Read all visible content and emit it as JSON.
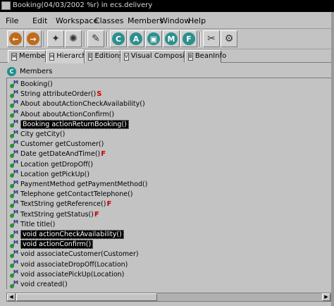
{
  "window": {
    "title": "Booking(04/03/2002 %r) in ecs.delivery"
  },
  "menu": [
    {
      "label": "File",
      "underline": "F"
    },
    {
      "label": "Edit",
      "underline": "E"
    },
    {
      "label": "Workspace",
      "underline": "W"
    },
    {
      "label": "Classes",
      "underline": "C"
    },
    {
      "label": "Members",
      "underline": "M"
    },
    {
      "label": "Window",
      "underline": "W"
    },
    {
      "label": "Help",
      "underline": "H"
    }
  ],
  "toolbar": {
    "buttons": [
      {
        "name": "back-arrow-icon",
        "glyph": "←"
      },
      {
        "name": "forward-arrow-icon",
        "glyph": "→"
      },
      {
        "name": "run-icon",
        "glyph": "✦"
      },
      {
        "name": "debug-icon",
        "glyph": "✺"
      },
      {
        "name": "search-flashlight-icon",
        "glyph": "✎"
      },
      {
        "name": "new-class-icon",
        "glyph": "C"
      },
      {
        "name": "new-applet-icon",
        "glyph": "A"
      },
      {
        "name": "new-window-icon",
        "glyph": "▣"
      },
      {
        "name": "new-method-icon",
        "glyph": "M"
      },
      {
        "name": "new-field-icon",
        "glyph": "F"
      },
      {
        "name": "cut-icon",
        "glyph": "✂"
      },
      {
        "name": "references-icon",
        "glyph": "⚙"
      }
    ]
  },
  "tabs": [
    {
      "label": "Members",
      "icon": "M"
    },
    {
      "label": "Hierarchy",
      "icon": "H"
    },
    {
      "label": "Editions",
      "icon": "E"
    },
    {
      "label": "Visual Composition",
      "icon": "V"
    },
    {
      "label": "BeanInfo",
      "icon": "B"
    }
  ],
  "active_tab": "Hierarchy",
  "panel": {
    "header_label": "Members",
    "header_icon": "C"
  },
  "members": [
    {
      "label": "Booking()",
      "selected": false,
      "flag": ""
    },
    {
      "label": "String attributeOrder()",
      "selected": false,
      "flag": "S"
    },
    {
      "label": "About aboutActionCheckAvailability()",
      "selected": false,
      "flag": ""
    },
    {
      "label": "About aboutActionConfirm()",
      "selected": false,
      "flag": ""
    },
    {
      "label": "Booking actionReturnBooking()",
      "selected": true,
      "flag": ""
    },
    {
      "label": "City getCity()",
      "selected": false,
      "flag": ""
    },
    {
      "label": "Customer getCustomer()",
      "selected": false,
      "flag": ""
    },
    {
      "label": "Date getDateAndTime()",
      "selected": false,
      "flag": "F"
    },
    {
      "label": "Location getDropOff()",
      "selected": false,
      "flag": ""
    },
    {
      "label": "Location getPickUp()",
      "selected": false,
      "flag": ""
    },
    {
      "label": "PaymentMethod getPaymentMethod()",
      "selected": false,
      "flag": ""
    },
    {
      "label": "Telephone getContactTelephone()",
      "selected": false,
      "flag": ""
    },
    {
      "label": "TextString getReference()",
      "selected": false,
      "flag": "F"
    },
    {
      "label": "TextString getStatus()",
      "selected": false,
      "flag": "F"
    },
    {
      "label": "Title title()",
      "selected": false,
      "flag": ""
    },
    {
      "label": "void actionCheckAvailability()",
      "selected": true,
      "flag": ""
    },
    {
      "label": "void actionConfirm()",
      "selected": true,
      "flag": ""
    },
    {
      "label": "void associateCustomer(Customer)",
      "selected": false,
      "flag": ""
    },
    {
      "label": "void associateDropOff(Location)",
      "selected": false,
      "flag": ""
    },
    {
      "label": "void associatePickUp(Location)",
      "selected": false,
      "flag": ""
    },
    {
      "label": "void created()",
      "selected": false,
      "flag": ""
    }
  ]
}
